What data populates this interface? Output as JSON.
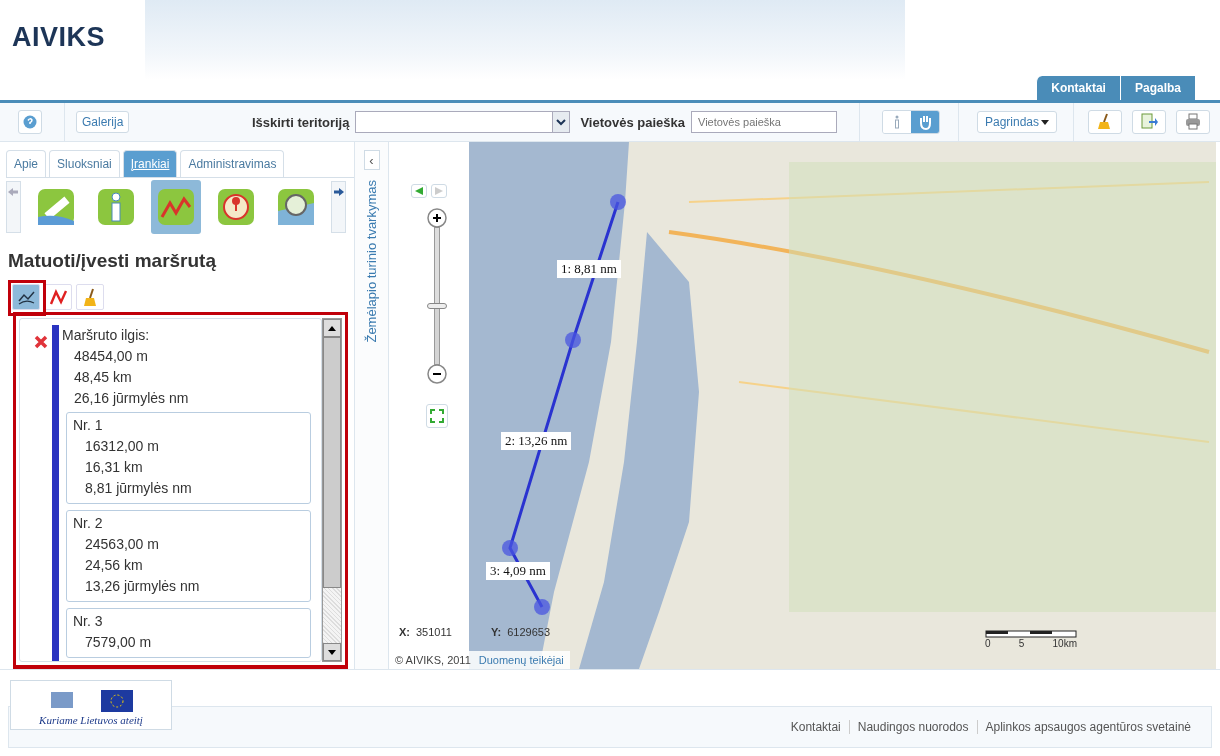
{
  "header": {
    "logo": "AIVIKS",
    "top_links": [
      {
        "label": "Kontaktai"
      },
      {
        "label": "Pagalba"
      }
    ]
  },
  "toolbar": {
    "gallery": "Galerija",
    "territory_label": "Išskirti teritoriją",
    "search_label": "Vietovės paieška",
    "search_placeholder": "Vietovės paieška",
    "mode_toggle": [
      {
        "kind": "info",
        "selected": false
      },
      {
        "kind": "pan",
        "selected": true
      }
    ],
    "basemap": "Pagrindas",
    "actions": [
      {
        "kind": "clear"
      },
      {
        "kind": "export"
      },
      {
        "kind": "print"
      }
    ]
  },
  "sidebar": {
    "tabs": [
      {
        "label": "Apie",
        "selected": false
      },
      {
        "label": "Sluoksniai",
        "selected": false
      },
      {
        "label": "Įrankiai",
        "selected": true
      },
      {
        "label": "Administravimas",
        "selected": false
      }
    ],
    "tools": [
      {
        "kind": "ruler",
        "selected": false
      },
      {
        "kind": "info",
        "selected": false
      },
      {
        "kind": "route",
        "selected": true
      },
      {
        "kind": "location",
        "selected": false
      },
      {
        "kind": "magnifier",
        "selected": false
      }
    ],
    "title": "Matuoti/įvesti maršrutą",
    "modes": [
      {
        "kind": "chart",
        "selected": true
      },
      {
        "kind": "line",
        "selected": false
      },
      {
        "kind": "clear",
        "selected": false
      }
    ],
    "route": {
      "label": "Maršruto ilgis:",
      "values": [
        "48454,00 m",
        "48,45 km",
        "26,16 jūrmylės nm"
      ],
      "segments": [
        {
          "title": "Nr. 1",
          "values": [
            "16312,00 m",
            "16,31 km",
            "8,81 jūrmylės nm"
          ]
        },
        {
          "title": "Nr. 2",
          "values": [
            "24563,00 m",
            "24,56 km",
            "13,26 jūrmylės nm"
          ]
        },
        {
          "title": "Nr. 3",
          "values": [
            "7579,00 m"
          ]
        }
      ]
    }
  },
  "toc": {
    "collapse": "‹",
    "label": "Žemėlapio turinio tvarkymas"
  },
  "map": {
    "zoom_slider": {
      "level": 0.43
    },
    "measurements": [
      "1: 8,81 nm",
      "2: 13,26 nm",
      "3: 4,09 nm"
    ],
    "x_label": "X:",
    "x_value": "351011",
    "y_label": "Y:",
    "y_value": "6129653",
    "copyright": "© AIVIKS, 2011",
    "providers": "Duomenų teikėjai",
    "scale": [
      "0",
      "5",
      "10km"
    ]
  },
  "footer": {
    "slogan": "Kuriame Lietuvos ateitį",
    "links": [
      "Kontaktai",
      "Naudingos nuorodos",
      "Aplinkos apsaugos agentūros svetainė"
    ]
  }
}
